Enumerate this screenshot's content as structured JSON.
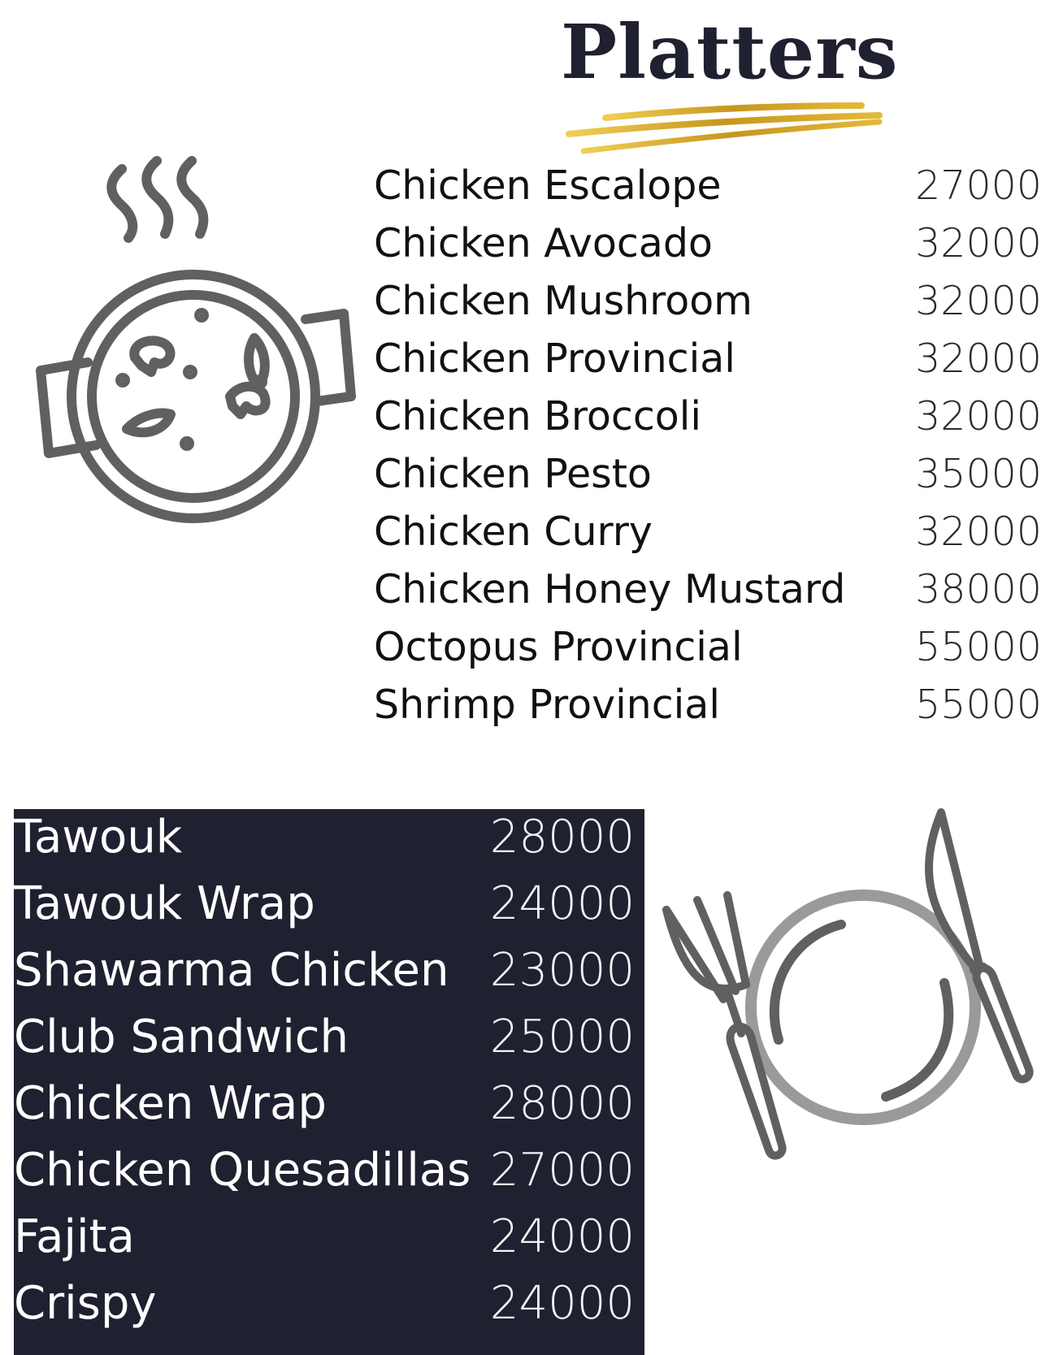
{
  "title": "Platters",
  "accent_gold": "#d4a72c",
  "dark_bg": "#1f2030",
  "icons": {
    "top": "steaming-pot-icon",
    "bottom": "plate-fork-knife-icon"
  },
  "platters": [
    {
      "name": "Chicken Escalope",
      "price": "27000"
    },
    {
      "name": "Chicken Avocado",
      "price": "32000"
    },
    {
      "name": "Chicken Mushroom",
      "price": "32000"
    },
    {
      "name": "Chicken Provincial",
      "price": "32000"
    },
    {
      "name": "Chicken Broccoli",
      "price": "32000"
    },
    {
      "name": "Chicken Pesto",
      "price": "35000"
    },
    {
      "name": "Chicken Curry",
      "price": "32000"
    },
    {
      "name": "Chicken Honey Mustard",
      "price": "38000"
    },
    {
      "name": "Octopus Provincial",
      "price": "55000"
    },
    {
      "name": "Shrimp Provincial",
      "price": "55000"
    }
  ],
  "wraps": [
    {
      "name": "Tawouk",
      "price": "28000"
    },
    {
      "name": "Tawouk Wrap",
      "price": "24000"
    },
    {
      "name": "Shawarma Chicken",
      "price": "23000"
    },
    {
      "name": "Club Sandwich",
      "price": "25000"
    },
    {
      "name": "Chicken Wrap",
      "price": "28000"
    },
    {
      "name": "Chicken Quesadillas",
      "price": "27000"
    },
    {
      "name": "Fajita",
      "price": "24000"
    },
    {
      "name": "Crispy",
      "price": "24000"
    }
  ]
}
